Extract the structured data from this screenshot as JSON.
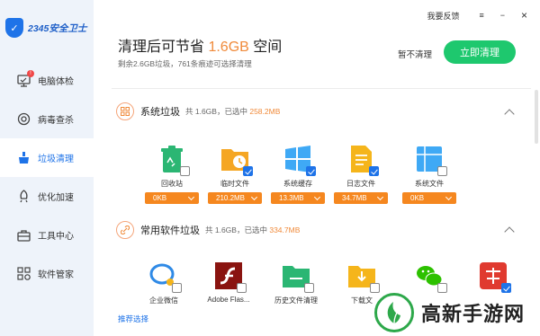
{
  "brand": {
    "logo_text": "2345安全卫士"
  },
  "sidebar": {
    "items": [
      {
        "label": "电脑体检",
        "icon": "monitor-icon",
        "badge": "!"
      },
      {
        "label": "病毒查杀",
        "icon": "target-icon"
      },
      {
        "label": "垃圾清理",
        "icon": "broom-icon",
        "active": true
      },
      {
        "label": "优化加速",
        "icon": "rocket-icon"
      },
      {
        "label": "工具中心",
        "icon": "toolbox-icon"
      },
      {
        "label": "软件管家",
        "icon": "apps-icon"
      }
    ]
  },
  "topbar": {
    "feedback": "我要反馈",
    "menu": "≡",
    "minimize": "−",
    "close": "×"
  },
  "summary": {
    "prefix": "清理后可节省 ",
    "amount": "1.6GB",
    "suffix": " 空间",
    "detail": "剩余2.6GB垃圾，761条痕迹可选择清理",
    "skip_label": "暂不清理",
    "clean_label": "立即清理"
  },
  "sections": [
    {
      "title": "系统垃圾",
      "total": "共 1.6GB，已选中",
      "selected": "258.2MB",
      "items": [
        {
          "label": "回收站",
          "size": "0KB",
          "checked": false,
          "icon": "recycle-bin-icon",
          "color": "#2bb673"
        },
        {
          "label": "临时文件",
          "size": "210.2MB",
          "checked": true,
          "icon": "temp-folder-icon",
          "color": "#f5a623"
        },
        {
          "label": "系统缓存",
          "size": "13.3MB",
          "checked": true,
          "icon": "windows-icon",
          "color": "#3fa9f5"
        },
        {
          "label": "日志文件",
          "size": "34.7MB",
          "checked": true,
          "icon": "log-file-icon",
          "color": "#f5b51b"
        },
        {
          "label": "系统文件",
          "size": "0KB",
          "checked": false,
          "icon": "system-file-icon",
          "color": "#3fa9f5"
        }
      ]
    },
    {
      "title": "常用软件垃圾",
      "total": "共 1.6GB，已选中",
      "selected": "334.7MB",
      "items": [
        {
          "label": "企业微信",
          "checked": false,
          "icon": "wecom-icon",
          "color": "#2f8ae6"
        },
        {
          "label": "Adobe Flas...",
          "checked": false,
          "icon": "flash-icon",
          "color": "#b3201a"
        },
        {
          "label": "历史文件清理",
          "checked": false,
          "icon": "green-folder-icon",
          "color": "#2bb673"
        },
        {
          "label": "下载文",
          "checked": false,
          "icon": "download-folder-icon",
          "color": "#f5b51b"
        },
        {
          "label": "",
          "checked": false,
          "icon": "wechat-icon",
          "color": "#2dc100"
        },
        {
          "label": "",
          "checked": true,
          "icon": "youdao-icon",
          "color": "#e03a2f"
        }
      ]
    }
  ],
  "recommend_label": "推荐选择",
  "watermark": {
    "text": "高新手游网"
  }
}
